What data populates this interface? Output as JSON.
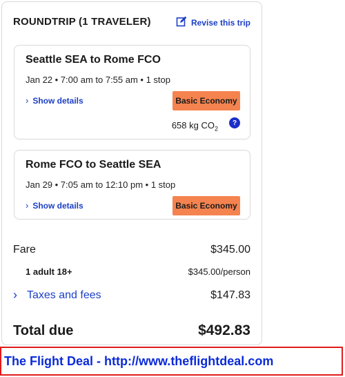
{
  "header": {
    "title": "ROUNDTRIP (1 TRAVELER)",
    "revise_label": "Revise this trip"
  },
  "flights": [
    {
      "route": "Seattle SEA to Rome FCO",
      "times": "Jan 22 • 7:00 am to 7:55 am • 1 stop",
      "details_label": "Show details",
      "fare_class": "Basic Economy",
      "co2_value": "658 kg CO",
      "co2_sub": "2",
      "info_icon": "?"
    },
    {
      "route": "Rome FCO to Seattle SEA",
      "times": "Jan 29 • 7:05 am to 12:10 pm • 1 stop",
      "details_label": "Show details",
      "fare_class": "Basic Economy"
    }
  ],
  "pricing": {
    "fare_label": "Fare",
    "fare_value": "$345.00",
    "adult_label": "1 adult 18+",
    "adult_value": "$345.00/person",
    "taxes_label": "Taxes and fees",
    "taxes_value": "$147.83",
    "total_label": "Total due",
    "total_value": "$492.83"
  },
  "footer": {
    "text": "The Flight Deal - http://www.theflightdeal.com"
  },
  "colors": {
    "link": "#1c3fc6",
    "badge": "#f5834f",
    "footer_border": "#e01b1b",
    "footer_text": "#0a2bd8"
  }
}
